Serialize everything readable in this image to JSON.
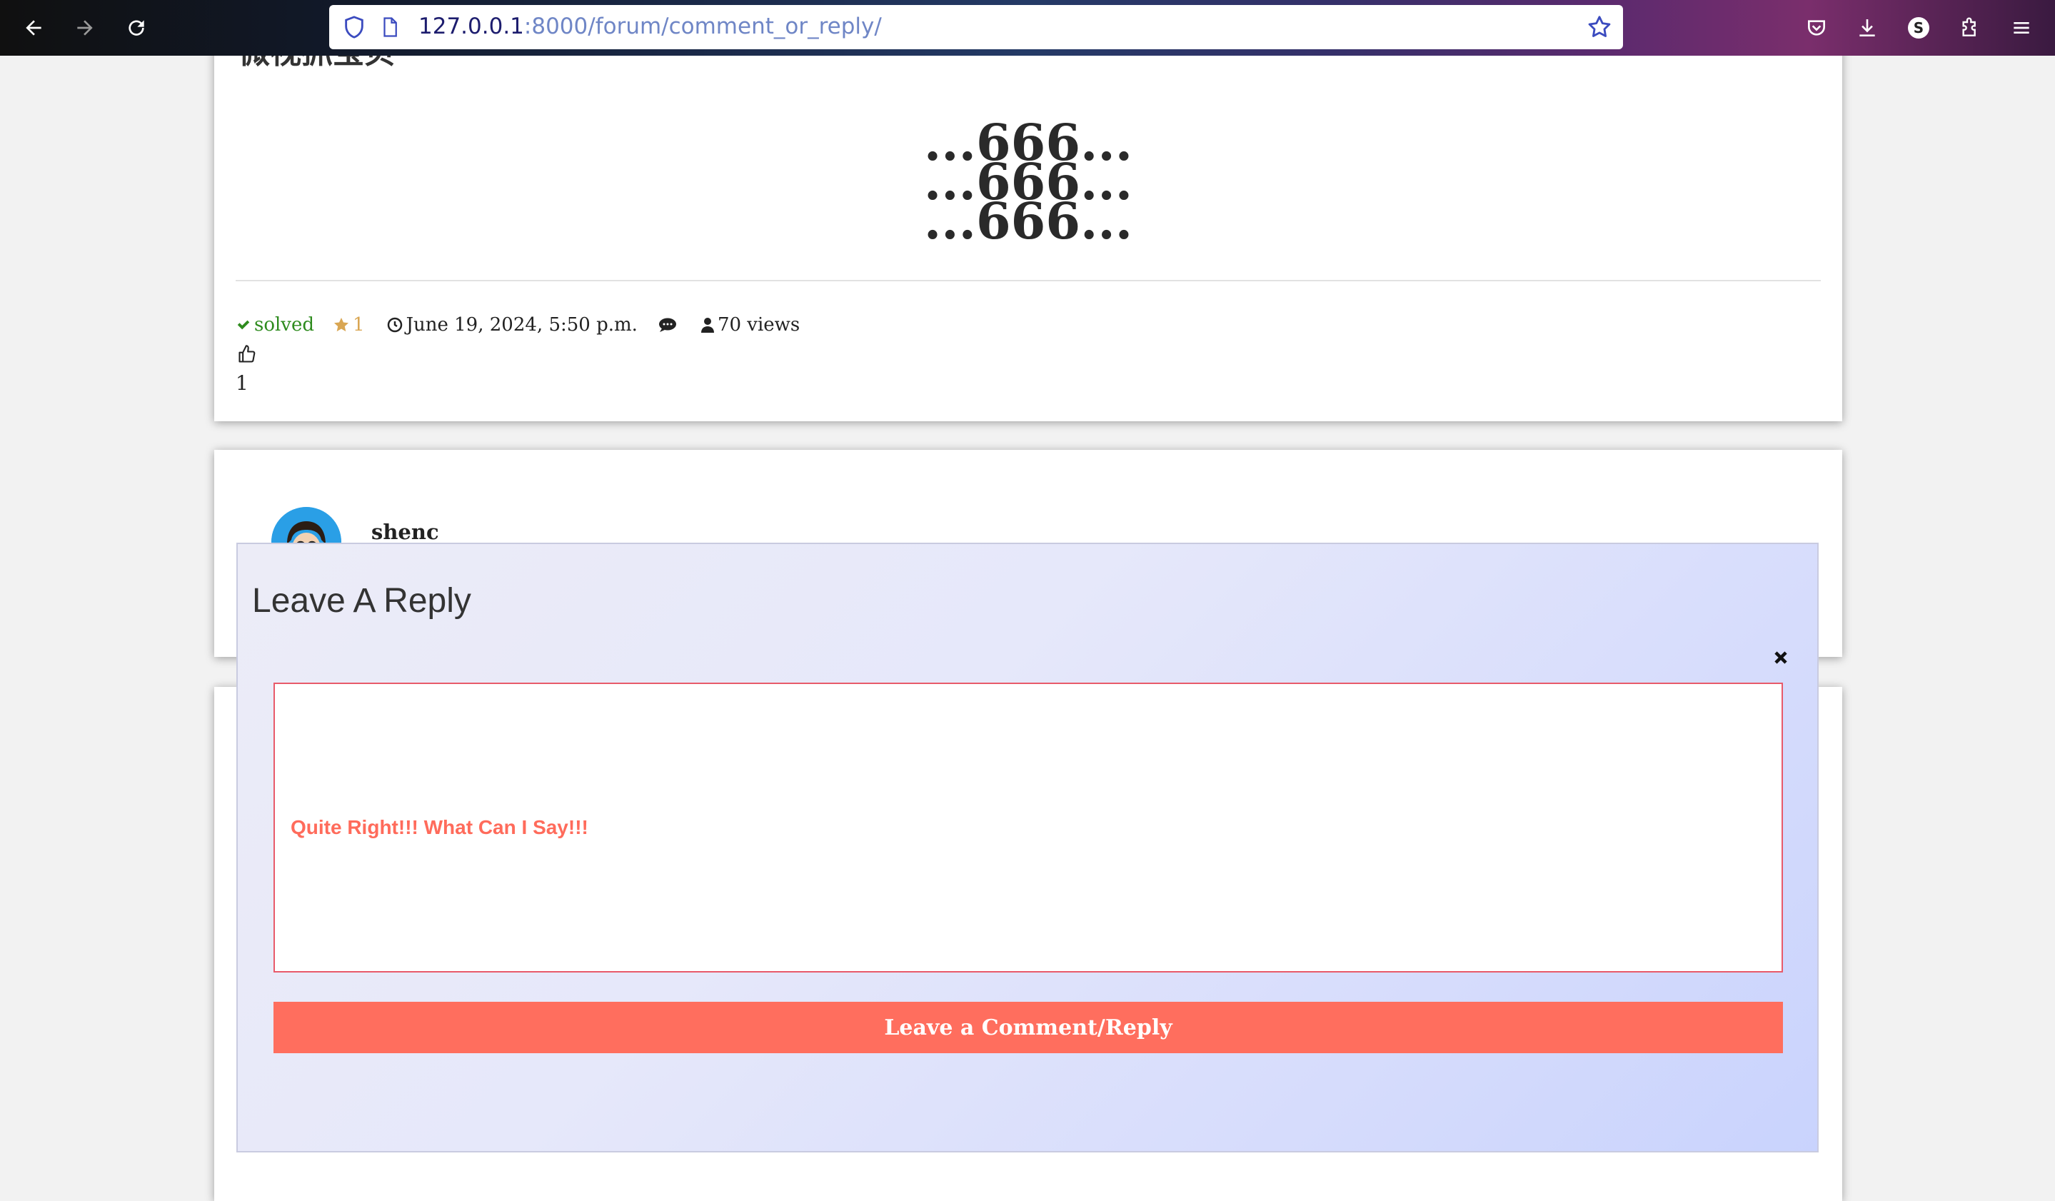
{
  "browser": {
    "url_host": "127.0.0.1",
    "url_path": ":8000/forum/comment_or_reply/",
    "profile_initial": "S"
  },
  "post": {
    "title": "微视抓宝贝",
    "content_lines": [
      "...666...",
      "...666...",
      "...666..."
    ],
    "status": "solved",
    "stars": "1",
    "date": "June 19, 2024, 5:50 p.m.",
    "views": "70 views",
    "likes": "1"
  },
  "comment": {
    "username": "shenc"
  },
  "modal": {
    "title": "Leave A Reply",
    "reply_text": "Quite Right!!! What Can I Say!!!",
    "submit_label": "Leave a Comment/Reply"
  },
  "colors": {
    "accent": "#ff6e5e",
    "solved_green": "#2e8b1e",
    "star_gold": "#d9a653",
    "modal_border": "#e85a6a"
  },
  "icons": [
    "back-arrow-icon",
    "forward-arrow-icon",
    "reload-icon",
    "shield-icon",
    "page-icon",
    "bookmark-star-icon",
    "pocket-icon",
    "download-icon",
    "extensions-icon",
    "menu-icon",
    "check-icon",
    "star-icon",
    "clock-icon",
    "comment-icon",
    "user-icon",
    "thumbs-up-icon",
    "close-icon"
  ]
}
